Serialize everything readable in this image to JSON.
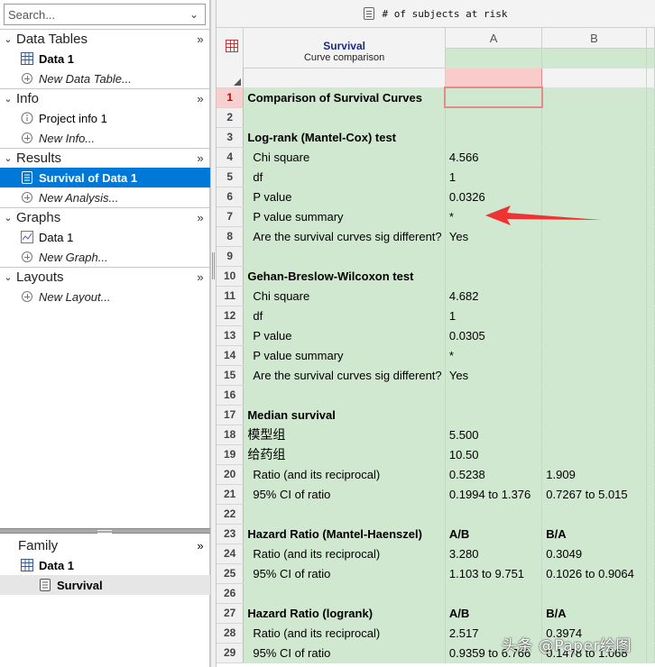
{
  "navigator": {
    "search_placeholder": "Search...",
    "sections": [
      {
        "title": "Data Tables",
        "items": [
          {
            "label": "Data 1",
            "icon": "table-icon",
            "style": "bold"
          },
          {
            "label": "New Data Table...",
            "icon": "plus-circle-icon",
            "style": "new"
          }
        ]
      },
      {
        "title": "Info",
        "items": [
          {
            "label": "Project info 1",
            "icon": "info-icon",
            "style": "normal"
          },
          {
            "label": "New Info...",
            "icon": "plus-circle-icon",
            "style": "new"
          }
        ]
      },
      {
        "title": "Results",
        "items": [
          {
            "label": "Survival of Data 1",
            "icon": "results-icon",
            "style": "selected"
          },
          {
            "label": "New Analysis...",
            "icon": "plus-circle-icon",
            "style": "new"
          }
        ]
      },
      {
        "title": "Graphs",
        "items": [
          {
            "label": "Data 1",
            "icon": "graph-icon",
            "style": "normal"
          },
          {
            "label": "New Graph...",
            "icon": "plus-circle-icon",
            "style": "new"
          }
        ]
      },
      {
        "title": "Layouts",
        "items": [
          {
            "label": "New Layout...",
            "icon": "plus-circle-icon",
            "style": "new"
          }
        ]
      }
    ]
  },
  "family": {
    "title": "Family",
    "items": [
      {
        "label": "Data 1",
        "icon": "table-icon"
      },
      {
        "label": "Survival",
        "icon": "results-icon"
      }
    ]
  },
  "sheet": {
    "toolbar_text": "# of subjects at risk",
    "title": "Survival",
    "subtitle": "Curve comparison",
    "columns": [
      "A",
      "B"
    ],
    "rows": [
      {
        "n": "1",
        "label": "Comparison of Survival Curves",
        "a": "",
        "b": "",
        "style": "hd"
      },
      {
        "n": "2",
        "label": "",
        "a": "",
        "b": "",
        "style": ""
      },
      {
        "n": "3",
        "label": "Log-rank (Mantel-Cox) test",
        "a": "",
        "b": "",
        "style": "hd"
      },
      {
        "n": "4",
        "label": "Chi square",
        "a": "4.566",
        "b": "",
        "style": "ind"
      },
      {
        "n": "5",
        "label": "df",
        "a": "1",
        "b": "",
        "style": "ind"
      },
      {
        "n": "6",
        "label": "P value",
        "a": "0.0326",
        "b": "",
        "style": "ind"
      },
      {
        "n": "7",
        "label": "P value summary",
        "a": "*",
        "b": "",
        "style": "ind"
      },
      {
        "n": "8",
        "label": "Are the survival curves sig different?",
        "a": "Yes",
        "b": "",
        "style": "ind"
      },
      {
        "n": "9",
        "label": "",
        "a": "",
        "b": "",
        "style": ""
      },
      {
        "n": "10",
        "label": "Gehan-Breslow-Wilcoxon test",
        "a": "",
        "b": "",
        "style": "hd"
      },
      {
        "n": "11",
        "label": "Chi square",
        "a": "4.682",
        "b": "",
        "style": "ind"
      },
      {
        "n": "12",
        "label": "df",
        "a": "1",
        "b": "",
        "style": "ind"
      },
      {
        "n": "13",
        "label": "P value",
        "a": "0.0305",
        "b": "",
        "style": "ind"
      },
      {
        "n": "14",
        "label": "P value summary",
        "a": "*",
        "b": "",
        "style": "ind"
      },
      {
        "n": "15",
        "label": "Are the survival curves sig different?",
        "a": "Yes",
        "b": "",
        "style": "ind"
      },
      {
        "n": "16",
        "label": "",
        "a": "",
        "b": "",
        "style": ""
      },
      {
        "n": "17",
        "label": "Median survival",
        "a": "",
        "b": "",
        "style": "hd"
      },
      {
        "n": "18",
        "label": "模型组",
        "a": "5.500",
        "b": "",
        "style": "cjk"
      },
      {
        "n": "19",
        "label": "给药组",
        "a": "10.50",
        "b": "",
        "style": "cjk"
      },
      {
        "n": "20",
        "label": "Ratio (and its reciprocal)",
        "a": "0.5238",
        "b": "1.909",
        "style": "ind"
      },
      {
        "n": "21",
        "label": "95% CI of ratio",
        "a": "0.1994 to 1.376",
        "b": "0.7267 to 5.015",
        "style": "ind"
      },
      {
        "n": "22",
        "label": "",
        "a": "",
        "b": "",
        "style": ""
      },
      {
        "n": "23",
        "label": "Hazard Ratio (Mantel-Haenszel)",
        "a": "A/B",
        "b": "B/A",
        "style": "hd hdv"
      },
      {
        "n": "24",
        "label": "Ratio (and its reciprocal)",
        "a": "3.280",
        "b": "0.3049",
        "style": "ind"
      },
      {
        "n": "25",
        "label": "95% CI of ratio",
        "a": "1.103 to 9.751",
        "b": "0.1026 to 0.9064",
        "style": "ind"
      },
      {
        "n": "26",
        "label": "",
        "a": "",
        "b": "",
        "style": ""
      },
      {
        "n": "27",
        "label": "Hazard Ratio (logrank)",
        "a": "A/B",
        "b": "B/A",
        "style": "hd hdv"
      },
      {
        "n": "28",
        "label": "Ratio (and its reciprocal)",
        "a": "2.517",
        "b": "0.3974",
        "style": "ind"
      },
      {
        "n": "29",
        "label": "95% CI of ratio",
        "a": "0.9359 to 6.766",
        "b": "0.1478 to 1.068",
        "style": "ind"
      }
    ]
  },
  "watermark": "头条 @Paper绘图",
  "colors": {
    "selected": "#0078d7",
    "cell_green": "#cfe8cf",
    "active_cell": "#f9cbcb",
    "arrow": "#ee3333"
  }
}
